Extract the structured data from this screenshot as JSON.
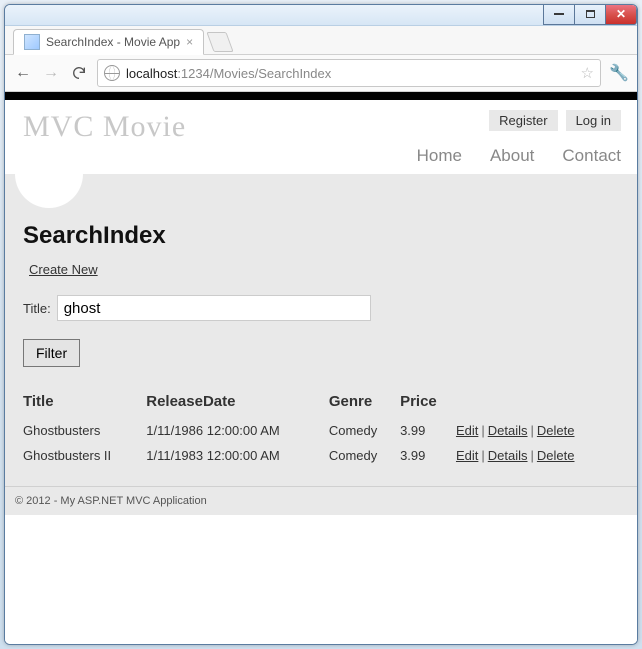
{
  "window": {
    "tab_title": "SearchIndex - Movie App"
  },
  "address": {
    "host": "localhost",
    "port": ":1234",
    "path": "/Movies/SearchIndex"
  },
  "site": {
    "brand": "MVC Movie",
    "auth": {
      "register": "Register",
      "login": "Log in"
    },
    "nav": {
      "home": "Home",
      "about": "About",
      "contact": "Contact"
    }
  },
  "page": {
    "heading": "SearchIndex",
    "create_new": "Create New",
    "search_label": "Title:",
    "search_value": "ghost",
    "filter_label": "Filter"
  },
  "table": {
    "headers": {
      "title": "Title",
      "release": "ReleaseDate",
      "genre": "Genre",
      "price": "Price"
    },
    "actions": {
      "edit": "Edit",
      "details": "Details",
      "delete": "Delete"
    },
    "rows": [
      {
        "title": "Ghostbusters",
        "release": "1/11/1986 12:00:00 AM",
        "genre": "Comedy",
        "price": "3.99"
      },
      {
        "title": "Ghostbusters II",
        "release": "1/11/1983 12:00:00 AM",
        "genre": "Comedy",
        "price": "3.99"
      }
    ]
  },
  "footer": "© 2012 - My ASP.NET MVC Application"
}
